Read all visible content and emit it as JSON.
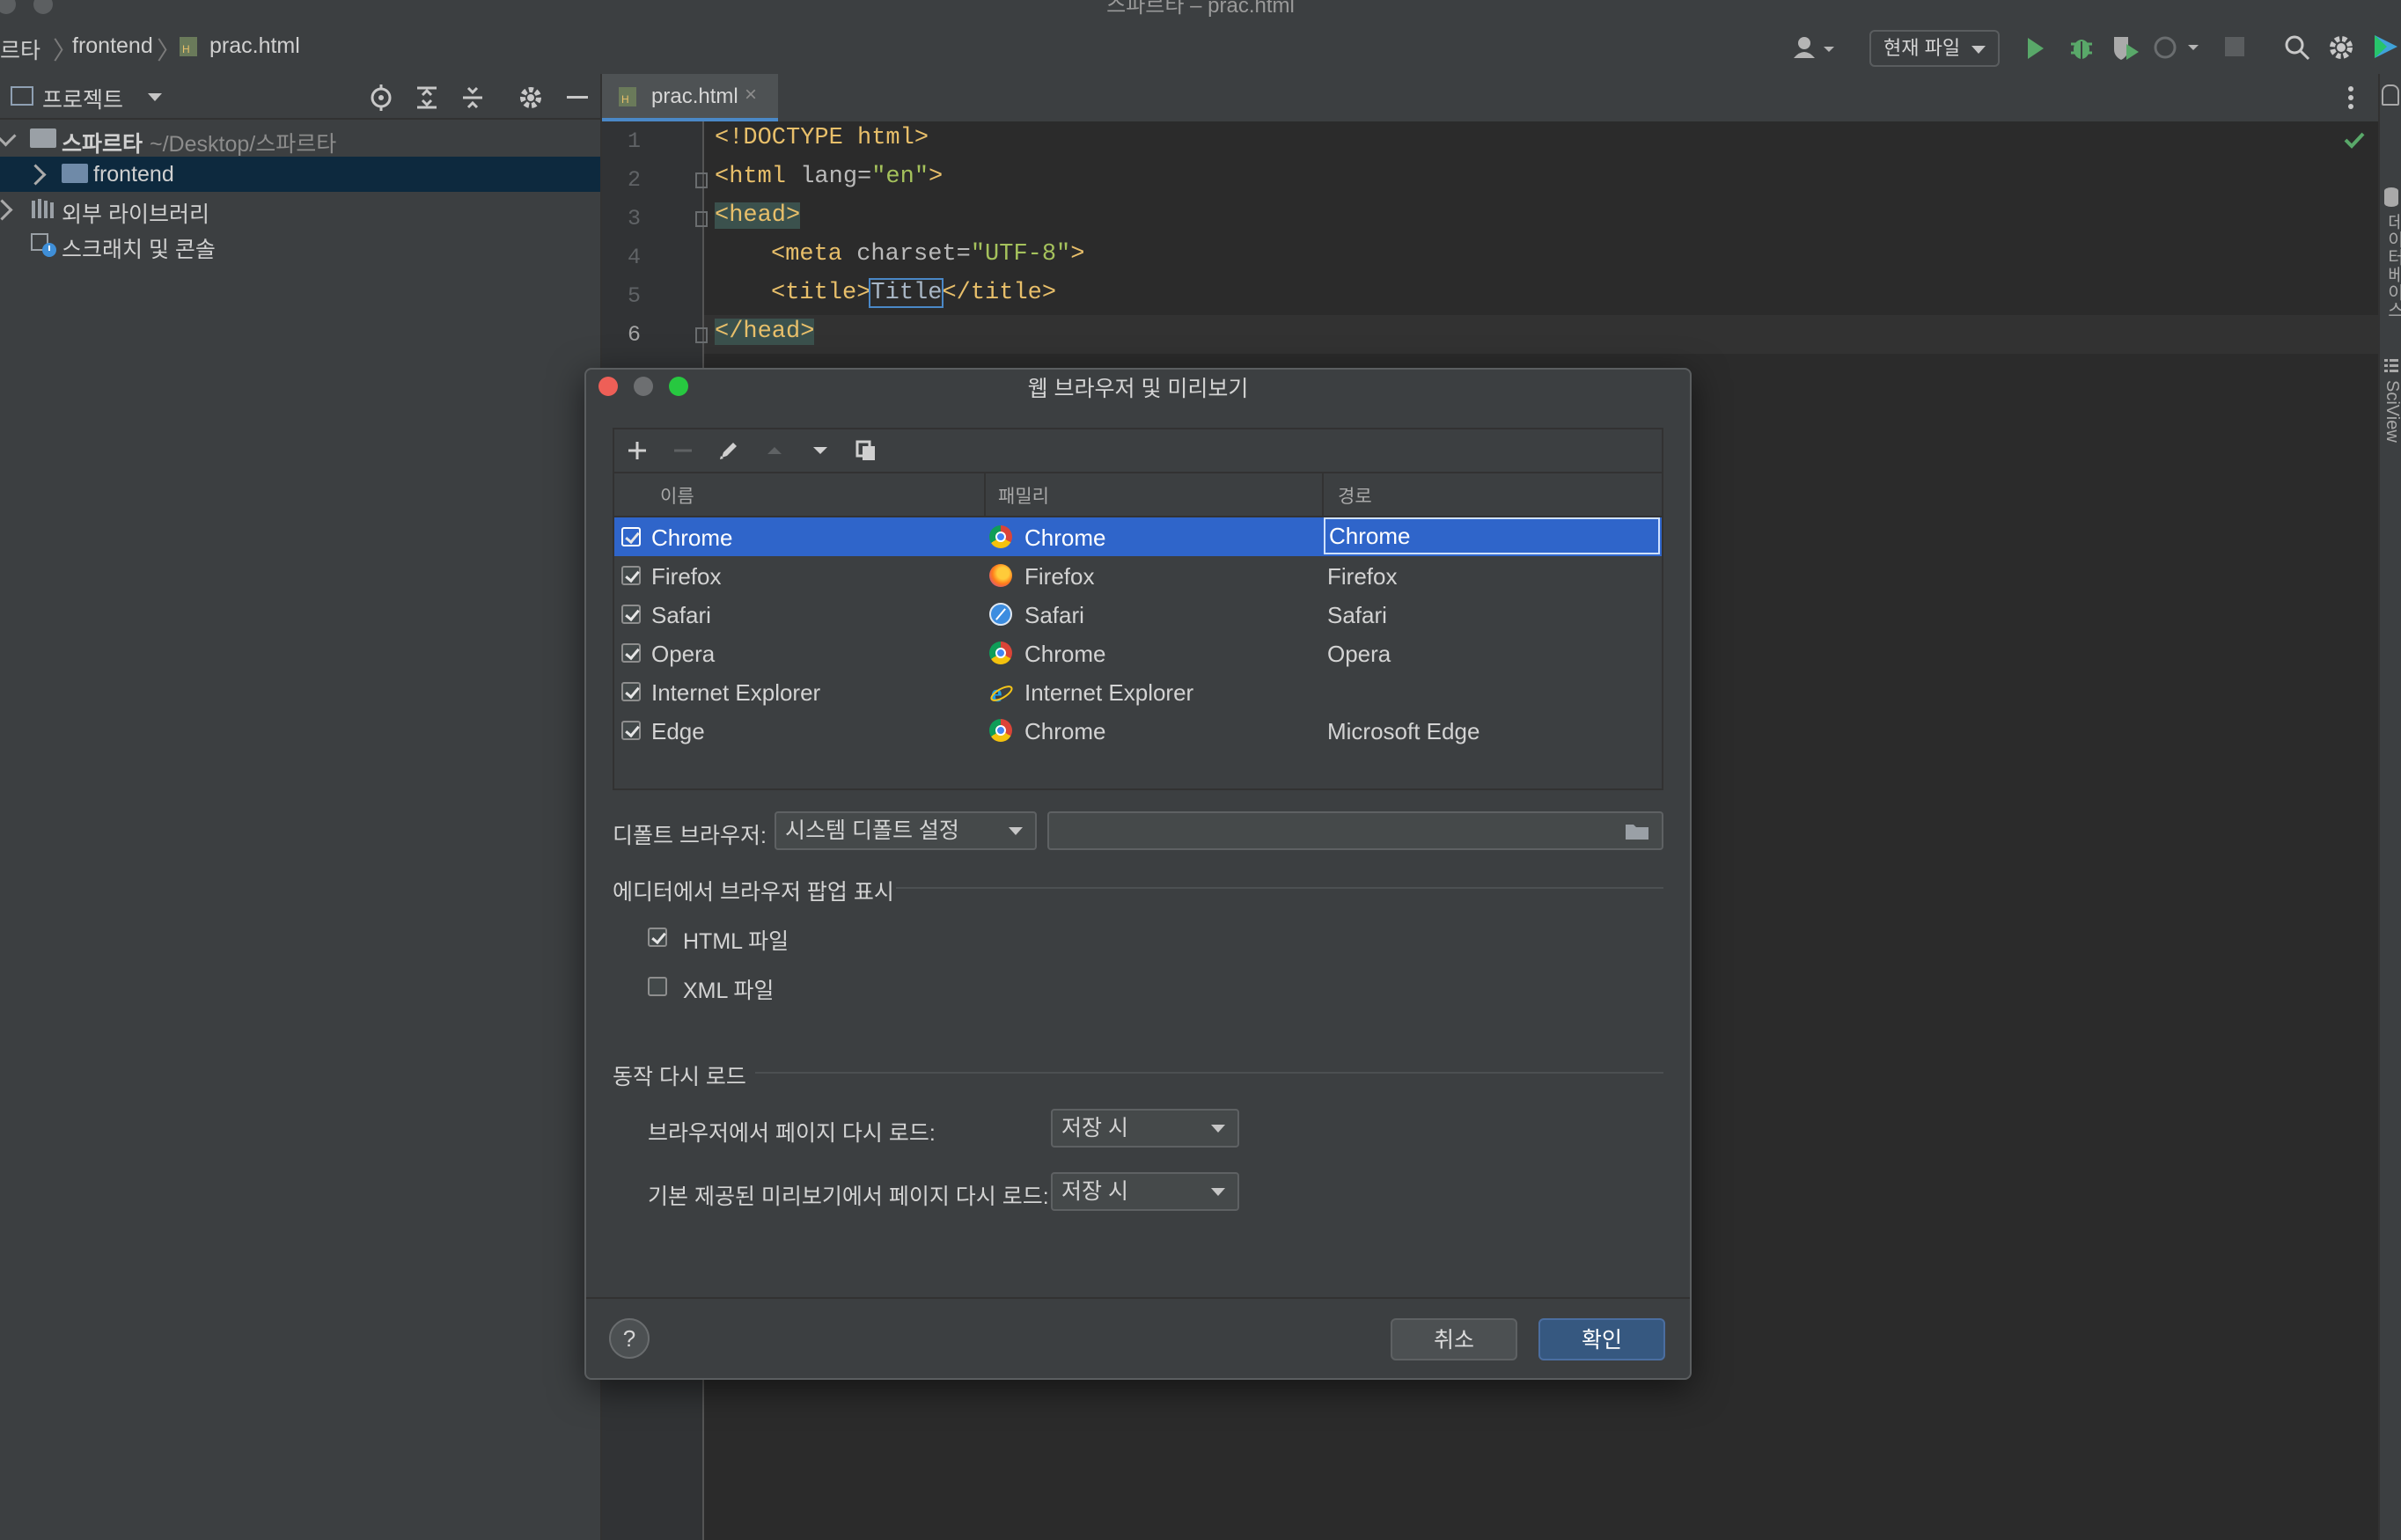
{
  "window": {
    "title": "스파르타 – prac.html"
  },
  "nav": {
    "breadcrumbs": [
      "르타",
      "frontend",
      "prac.html"
    ],
    "run_config": "현재 파일"
  },
  "project": {
    "panel_title": "프로젝트",
    "root_name": "스파르타",
    "root_path": "~/Desktop/스파르타",
    "items": [
      {
        "label": "frontend"
      },
      {
        "label": "외부 라이브러리"
      },
      {
        "label": "스크래치 및 콘솔"
      }
    ]
  },
  "editor": {
    "tab_label": "prac.html",
    "line_numbers": [
      "1",
      "2",
      "3",
      "4",
      "5",
      "6"
    ],
    "lines": {
      "l1": "<!DOCTYPE html>",
      "l2a": "<html ",
      "l2b": "lang=",
      "l2c": "\"en\"",
      "l2d": ">",
      "l3": "<head>",
      "l4a": "<meta ",
      "l4b": "charset=",
      "l4c": "\"UTF-8\"",
      "l4d": ">",
      "l5a": "<title>",
      "l5b": "Title",
      "l5c": "</title>",
      "l6": "</head>"
    }
  },
  "right_strip": {
    "tab1": "데이터베이스",
    "tab2": "SciView"
  },
  "dialog": {
    "title": "웹 브라우저 및 미리보기",
    "columns": {
      "name": "이름",
      "family": "패밀리",
      "path": "경로"
    },
    "browsers": [
      {
        "name": "Chrome",
        "family": "Chrome",
        "path": "Chrome",
        "checked": true,
        "icon": "chrome-icon"
      },
      {
        "name": "Firefox",
        "family": "Firefox",
        "path": "Firefox",
        "checked": true,
        "icon": "firefox-icon"
      },
      {
        "name": "Safari",
        "family": "Safari",
        "path": "Safari",
        "checked": true,
        "icon": "safari-icon"
      },
      {
        "name": "Opera",
        "family": "Chrome",
        "path": "Opera",
        "checked": true,
        "icon": "chrome-icon"
      },
      {
        "name": "Internet Explorer",
        "family": "Internet Explorer",
        "path": "",
        "checked": true,
        "icon": "ie-icon"
      },
      {
        "name": "Edge",
        "family": "Chrome",
        "path": "Microsoft Edge",
        "checked": true,
        "icon": "chrome-icon"
      }
    ],
    "default_browser_label": "디폴트 브라우저:",
    "default_browser_value": "시스템 디폴트 설정",
    "default_browser_path": "",
    "popup_section": "에디터에서 브라우저 팝업 표시",
    "html_files": "HTML 파일",
    "html_files_checked": true,
    "xml_files": "XML 파일",
    "xml_files_checked": false,
    "reload_section": "동작 다시 로드",
    "reload_browser_label": "브라우저에서 페이지 다시 로드:",
    "reload_browser_value": "저장 시",
    "reload_preview_label": "기본 제공된 미리보기에서 페이지 다시 로드:",
    "reload_preview_value": "저장 시",
    "help": "?",
    "cancel": "취소",
    "ok": "확인"
  },
  "colors": {
    "selection": "#2f65ca",
    "tag": "#e8bf6a",
    "string": "#a5c25c",
    "run_green": "#59a869",
    "ok_button": "#365880"
  }
}
